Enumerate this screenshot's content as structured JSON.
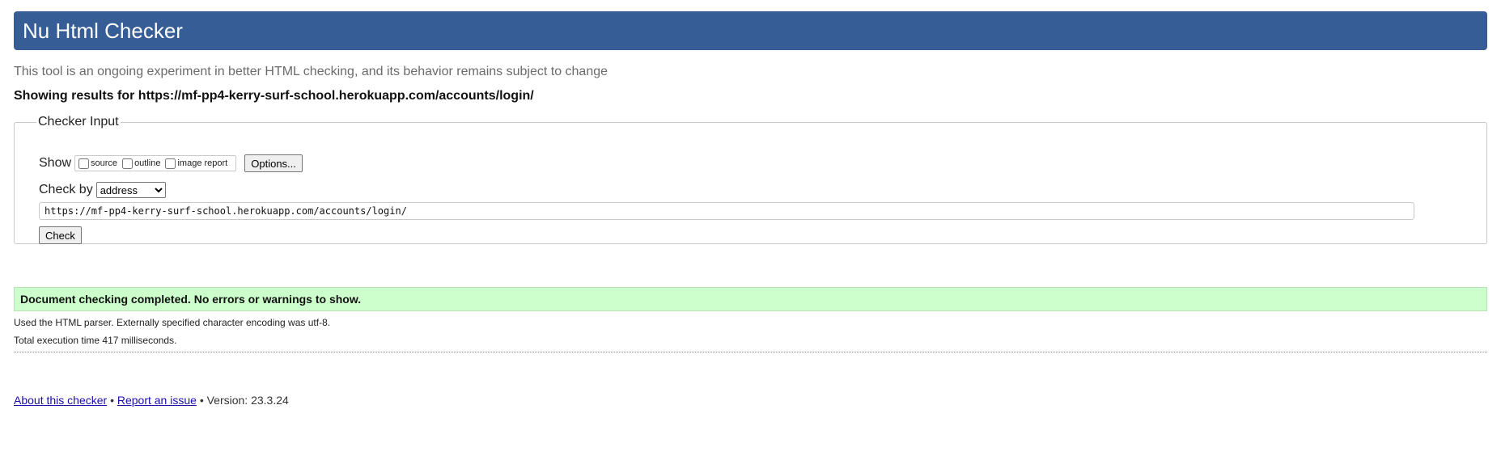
{
  "header": {
    "title": "Nu Html Checker"
  },
  "tagline": "This tool is an ongoing experiment in better HTML checking, and its behavior remains subject to change",
  "results_heading": "Showing results for https://mf-pp4-kerry-surf-school.herokuapp.com/accounts/login/",
  "checker_input": {
    "legend": "Checker Input",
    "show_label": "Show",
    "show_options": [
      {
        "label": "source",
        "checked": false
      },
      {
        "label": "outline",
        "checked": false
      },
      {
        "label": "image report",
        "checked": false
      }
    ],
    "options_button": "Options...",
    "check_by_label": "Check by",
    "check_by_value": "address",
    "url_value": "https://mf-pp4-kerry-surf-school.herokuapp.com/accounts/login/",
    "check_button": "Check"
  },
  "result": {
    "message": "Document checking completed. No errors or warnings to show.",
    "notes": [
      "Used the HTML parser. Externally specified character encoding was utf-8.",
      "Total execution time 417 milliseconds."
    ]
  },
  "footer": {
    "about_link": "About this checker",
    "separator": "•",
    "report_link": "Report an issue",
    "version": "Version: 23.3.24"
  },
  "colors": {
    "banner": "#365d95",
    "success_bg": "#ccffcc",
    "link": "#1a0dab"
  }
}
